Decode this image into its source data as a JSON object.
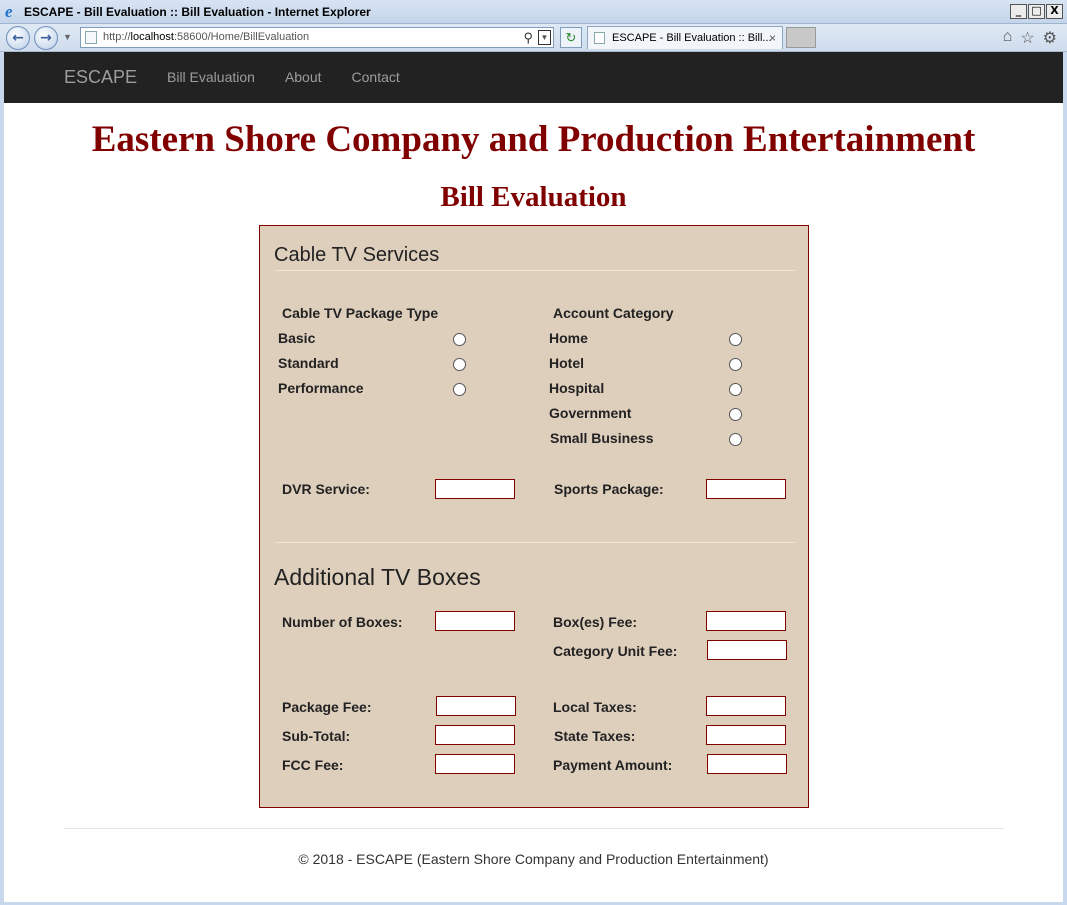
{
  "browser": {
    "window_title": "ESCAPE - Bill Evaluation :: Bill Evaluation - Internet Explorer",
    "url_prefix": "http://",
    "url_host": "localhost",
    "url_rest": ":58600/Home/BillEvaluation",
    "tab_title": "ESCAPE - Bill Evaluation :: Bill...",
    "min_glyph": "_",
    "max_glyph": "□",
    "close_glyph": "X",
    "tab_close_glyph": "×"
  },
  "navbar": {
    "brand": "ESCAPE",
    "links": [
      "Bill Evaluation",
      "About",
      "Contact"
    ]
  },
  "header": {
    "company": "Eastern Shore Company and Production Entertainment",
    "page_title": "Bill Evaluation"
  },
  "cable": {
    "section_title": "Cable TV Services",
    "package_heading": "Cable TV Package Type",
    "packages": [
      "Basic",
      "Standard",
      "Performance"
    ],
    "account_heading": "Account Category",
    "accounts": [
      "Home",
      "Hotel",
      "Hospital",
      "Government",
      "Small Business"
    ],
    "dvr_label": "DVR Service:",
    "dvr_value": "",
    "sports_label": "Sports Package:",
    "sports_value": ""
  },
  "boxes": {
    "section_title": "Additional TV Boxes",
    "num_boxes_label": "Number of Boxes:",
    "box_fee_label": "Box(es) Fee:",
    "category_unit_fee_label": "Category Unit Fee:",
    "package_fee_label": "Package Fee:",
    "local_taxes_label": "Local Taxes:",
    "subtotal_label": "Sub-Total:",
    "state_taxes_label": "State Taxes:",
    "fcc_fee_label": "FCC Fee:",
    "payment_amount_label": "Payment Amount:"
  },
  "footer": {
    "text": "© 2018 - ESCAPE (Eastern Shore Company and Production Entertainment)"
  },
  "colors": {
    "heading": "#800000",
    "panel_bg": "#decfbd",
    "navbar_bg": "#222222"
  },
  "icons": [
    "ie-logo-icon",
    "back-icon",
    "forward-icon",
    "search-icon",
    "refresh-icon",
    "home-icon",
    "favorites-star-icon",
    "settings-gear-icon"
  ]
}
